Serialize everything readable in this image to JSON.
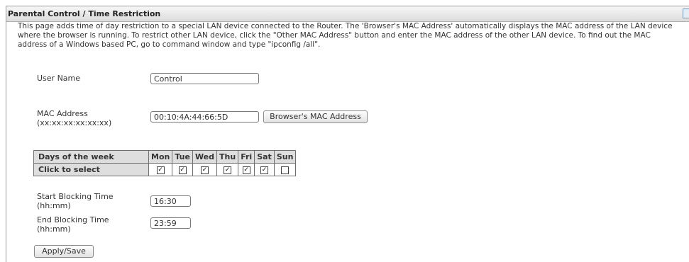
{
  "page": {
    "title": "Parental Control / Time Restriction",
    "description": "This page adds time of day restriction to a special LAN device connected to the Router. The 'Browser's MAC Address' automatically displays the MAC address of the LAN device where the browser is running. To restrict other LAN device, click the \"Other MAC Address\" button and enter the MAC address of the other LAN device. To find out the MAC address of a Windows based PC, go to command window and type \"ipconfig /all\"."
  },
  "form": {
    "user_name_label": "User Name",
    "user_name_value": "Control",
    "mac_label": "MAC Address",
    "mac_format": "(xx:xx:xx:xx:xx:xx)",
    "mac_value": "00:10:4A:44:66:5D",
    "browser_mac_button": "Browser's MAC Address",
    "start_label": "Start Blocking Time",
    "start_format": "(hh:mm)",
    "start_value": "16:30",
    "end_label": "End Blocking Time",
    "end_format": "(hh:mm)",
    "end_value": "23:59",
    "apply_button": "Apply/Save"
  },
  "days_table": {
    "header_label": "Days of the week",
    "select_label": "Click to select",
    "days": [
      {
        "name": "Mon",
        "checked": true
      },
      {
        "name": "Tue",
        "checked": true
      },
      {
        "name": "Wed",
        "checked": true
      },
      {
        "name": "Thu",
        "checked": true
      },
      {
        "name": "Fri",
        "checked": true
      },
      {
        "name": "Sat",
        "checked": true
      },
      {
        "name": "Sun",
        "checked": false
      }
    ]
  }
}
